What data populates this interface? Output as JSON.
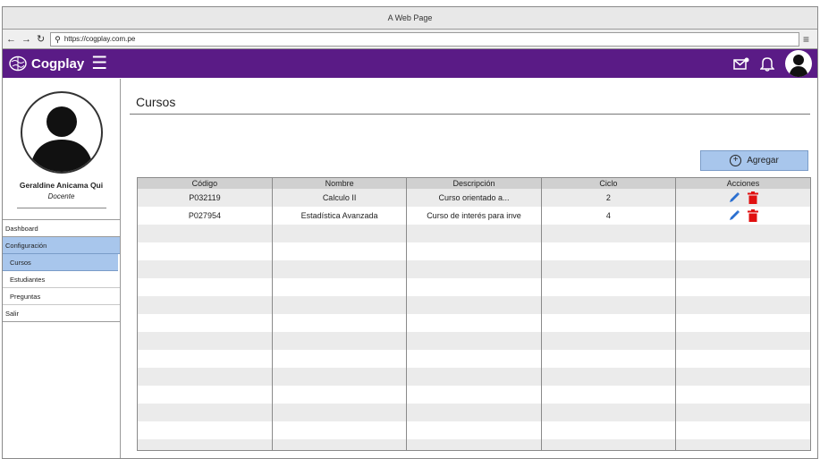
{
  "browser": {
    "title": "A Web Page",
    "url": "https://cogplay.com.pe"
  },
  "app": {
    "brand": "Cogplay",
    "accent_color": "#5a1b86"
  },
  "user": {
    "name": "Geraldine Anicama Qui",
    "role": "Docente"
  },
  "menu": {
    "dashboard": "Dashboard",
    "configuracion": "Configuración",
    "cursos": "Cursos",
    "estudiantes": "Estudiantes",
    "preguntas": "Preguntas",
    "salir": "Salir"
  },
  "page": {
    "title": "Cursos",
    "add_label": "Agregar"
  },
  "table": {
    "headers": [
      "Código",
      "Nombre",
      "Descripción",
      "Ciclo",
      "Acciones"
    ],
    "rows": [
      [
        "P032119",
        "Calculo II",
        "Curso orientado a...",
        "2"
      ],
      [
        "P027954",
        "Estadística Avanzada",
        "Curso de interés para inve",
        "4"
      ]
    ],
    "empty_rows": 13
  }
}
